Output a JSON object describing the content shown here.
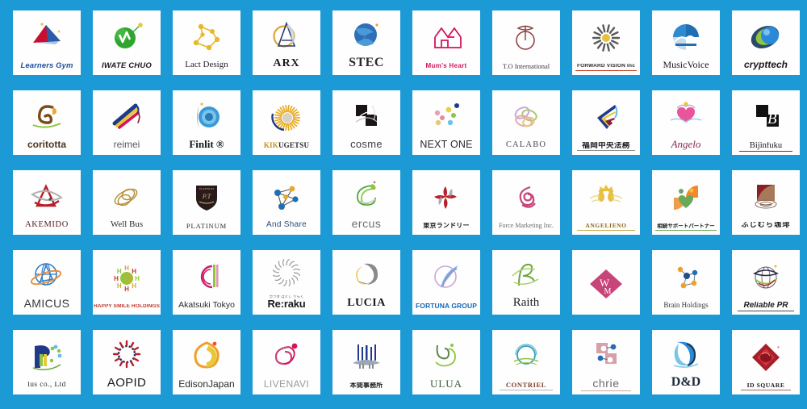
{
  "page": {
    "title": "Logo Design Portfolio Grid",
    "background_color": "#1b9ad6",
    "tile_background": "#fefefe",
    "columns": 10,
    "rows": 5,
    "total_logos": 50
  },
  "logos": [
    {
      "name": "Learners Gym",
      "caption": "Learners Gym",
      "mark": "triangle-flag-mark",
      "colors": [
        "#c8102e",
        "#1b4f9c",
        "#e8c040"
      ]
    },
    {
      "name": "IWATE CHUO",
      "caption": "IWATE CHUO",
      "mark": "green-circle-check-mark",
      "colors": [
        "#2fa42f",
        "#8ec63f"
      ]
    },
    {
      "name": "Lact Design",
      "caption": "Lact Design",
      "mark": "molecule-dots-mark",
      "colors": [
        "#e8b82a"
      ]
    },
    {
      "name": "ARX",
      "caption": "ARX",
      "mark": "gold-circle-a-mark",
      "colors": [
        "#d8a83a",
        "#2a4a8a"
      ]
    },
    {
      "name": "STEC",
      "caption": "STEC",
      "mark": "blue-globe-swoosh-mark",
      "colors": [
        "#1f5fa8",
        "#4a9ad8"
      ]
    },
    {
      "name": "Mum's Heart",
      "caption": "Mum's Heart",
      "mark": "pink-house-heart-mark",
      "colors": [
        "#d4145a"
      ]
    },
    {
      "name": "T.O International",
      "caption": "T.O International",
      "mark": "wine-circle-line-mark",
      "colors": [
        "#8a3a3a"
      ]
    },
    {
      "name": "FORWARD VISION Inc",
      "caption": "FORWARD  VISION  Inc",
      "mark": "burst-scatter-mark",
      "colors": [
        "#5a5a5a",
        "#e8c040"
      ]
    },
    {
      "name": "MusicVoice",
      "caption": "MusicVoice",
      "mark": "blue-fan-wave-mark",
      "colors": [
        "#1f6fb5"
      ]
    },
    {
      "name": "crypttech",
      "caption": "crypttech",
      "mark": "blue-green-sphere-mark",
      "colors": [
        "#1f6fb5",
        "#8ec63f"
      ]
    },
    {
      "name": "coritotta",
      "caption": "coritotta",
      "mark": "brown-ribbon-swirl-mark",
      "colors": [
        "#7a4a1a",
        "#e8a83a",
        "#8ec63f"
      ]
    },
    {
      "name": "reimei",
      "caption": "reimei",
      "mark": "colored-brush-strokes-mark",
      "colors": [
        "#1f3a8a",
        "#e8c83a",
        "#d4145a"
      ]
    },
    {
      "name": "Finlit",
      "caption": "Finlit ®",
      "mark": "blue-spiral-circle-mark",
      "colors": [
        "#2a8ad8",
        "#8a9aa8"
      ]
    },
    {
      "name": "KIKUGETSU",
      "caption": "KIKUGETSU",
      "caption_highlight": "KIK",
      "caption_rest": "UGETSU",
      "mark": "gold-sunburst-mark",
      "colors": [
        "#e8a81a",
        "#1f3a8a"
      ]
    },
    {
      "name": "cosme",
      "caption": "cosme",
      "mark": "black-squares-swirl-mark",
      "colors": [
        "#1a1414"
      ]
    },
    {
      "name": "NEXT ONE",
      "caption": "NEXT ONE",
      "mark": "colored-dots-scatter-mark",
      "colors": [
        "#e8a0b8",
        "#e8d04a",
        "#8ec63f",
        "#1f3a8a",
        "#4ab8d8"
      ]
    },
    {
      "name": "CALABO",
      "caption": "CALABO",
      "mark": "pastel-loops-mark",
      "colors": [
        "#c8a8d8",
        "#a8c878",
        "#e8a8a8"
      ]
    },
    {
      "name": "Fukuoka Chuo Houmu",
      "caption": "福岡中央法務",
      "mark": "tricolor-chevron-mark",
      "colors": [
        "#1f3a8a",
        "#e8c83a",
        "#8a1f35"
      ]
    },
    {
      "name": "Angelo",
      "caption": "Angelo",
      "mark": "pink-heart-wings-mark",
      "colors": [
        "#e8559a",
        "#8ac8e8",
        "#e8c83a"
      ]
    },
    {
      "name": "Bijinfuku",
      "caption": "Bijinfuku",
      "mark": "black-squares-b-mark",
      "colors": [
        "#1a1a1a",
        "#8a1f35"
      ]
    },
    {
      "name": "AKEMIDO",
      "caption": "AKEMIDO",
      "mark": "red-swoosh-a-mark",
      "colors": [
        "#b5202a",
        "#9a9a9a"
      ]
    },
    {
      "name": "Well Bus",
      "caption": "Well Bus",
      "mark": "gold-ellipse-loops-mark",
      "colors": [
        "#b5933a"
      ]
    },
    {
      "name": "PLATINUM",
      "caption": "PLATINUM",
      "mark": "dark-shield-crest-mark",
      "colors": [
        "#2a1a1a",
        "#c8b87a"
      ]
    },
    {
      "name": "And Share",
      "caption": "And  Share",
      "mark": "network-nodes-mark",
      "colors": [
        "#1f6fb5",
        "#e8a82a"
      ]
    },
    {
      "name": "ercus",
      "caption": "ercus",
      "mark": "green-leaf-swirl-mark",
      "colors": [
        "#4aa83a",
        "#8ec63f"
      ]
    },
    {
      "name": "Tokyo Laundry",
      "caption": "東京ランドリー",
      "mark": "red-pinwheel-mark",
      "colors": [
        "#b5202a",
        "#9a9a9a"
      ]
    },
    {
      "name": "Force Marketing Inc.",
      "caption": "Force Marketing Inc.",
      "mark": "pink-ribbon-knot-mark",
      "colors": [
        "#c8457a"
      ]
    },
    {
      "name": "ANGELIENO",
      "caption": "ANGELIENO",
      "mark": "gold-angels-crown-mark",
      "colors": [
        "#e8c040",
        "#c8a84a"
      ]
    },
    {
      "name": "Souzoku Support Partner",
      "caption": "相続サポートパートナー",
      "mark": "orange-green-people-mark",
      "colors": [
        "#f08a2a",
        "#6aa85a"
      ]
    },
    {
      "name": "Fujimura Coffee",
      "caption": "ふじむら珈琲",
      "mark": "brown-coffee-cup-mark",
      "colors": [
        "#8a1f25",
        "#a8785a"
      ]
    },
    {
      "name": "AMICUS",
      "caption": "AMICUS",
      "mark": "blue-globe-ring-mark",
      "colors": [
        "#2a7ac8",
        "#f08a2a"
      ]
    },
    {
      "name": "HAPPY SMILE HOLDINGS",
      "caption": "HAPPY SMILE HOLDINGS",
      "mark": "colorful-h-sun-mark",
      "colors": [
        "#d4a82a",
        "#c0392b",
        "#8ec63f"
      ]
    },
    {
      "name": "Akatsuki Tokyo",
      "caption": "Akatsuki Tokyo",
      "mark": "magenta-circle-bar-mark",
      "colors": [
        "#c8206a",
        "#8ec63f"
      ]
    },
    {
      "name": "Re:raku",
      "caption": "Re:raku",
      "caption_top": "カラダ ほぐし りらく",
      "mark": "line-burst-circle-mark",
      "colors": [
        "#9a9a9a"
      ]
    },
    {
      "name": "LUCIA",
      "caption": "LUCIA",
      "mark": "gold-gray-shell-mark",
      "colors": [
        "#e8b82a",
        "#8a8a8a"
      ]
    },
    {
      "name": "FORTUNA GROUP",
      "caption": "FORTUNA GROUP",
      "mark": "pastel-circle-swoosh-mark",
      "colors": [
        "#c8a8d8",
        "#6ab8e8"
      ]
    },
    {
      "name": "Raith",
      "caption": "Raith",
      "mark": "green-script-r-mark",
      "colors": [
        "#6aa83a"
      ]
    },
    {
      "name": "WM",
      "caption": "",
      "mark": "pink-diamond-wm-mark",
      "colors": [
        "#c8457a"
      ]
    },
    {
      "name": "Brain Holdings",
      "caption": "Brain Holdings",
      "mark": "molecule-network-mark",
      "colors": [
        "#1f6fb5",
        "#f0a02a"
      ]
    },
    {
      "name": "Reliable PR",
      "caption": "Reliable PR",
      "mark": "globe-ribbon-mark",
      "colors": [
        "#4a4a4a",
        "#8ac63f",
        "#b5202a"
      ]
    },
    {
      "name": "Plus co., Ltd",
      "caption": "lus  co., Ltd",
      "caption_prefix": "P",
      "mark": "blue-p-dots-mark",
      "colors": [
        "#1f3a8a",
        "#8ec63f",
        "#4a9ad8"
      ]
    },
    {
      "name": "AOPID",
      "caption": "AOPID",
      "mark": "red-ring-burst-mark",
      "colors": [
        "#b5202a",
        "#2a2a5a"
      ]
    },
    {
      "name": "EdisonJapan",
      "caption": "EdisonJapan",
      "mark": "orange-leaf-swirl-mark",
      "colors": [
        "#f0a02a",
        "#e8c83a"
      ]
    },
    {
      "name": "LIVENAVI",
      "caption": "LIVENAVI",
      "mark": "pink-butterfly-loop-mark",
      "colors": [
        "#c8457a",
        "#d4145a"
      ]
    },
    {
      "name": "Honma Jimusho",
      "caption": "本間事務所",
      "mark": "blue-pillars-mark",
      "colors": [
        "#1f3a8a",
        "#8a8a8a"
      ]
    },
    {
      "name": "ULUA",
      "caption": "ULUA",
      "mark": "green-script-swirl-mark",
      "colors": [
        "#5a8a4a",
        "#8ec63f"
      ]
    },
    {
      "name": "CONTRIEL",
      "caption": "CONTRIEL",
      "mark": "teal-circle-lines-mark",
      "colors": [
        "#3a9ab5",
        "#8ec63f"
      ]
    },
    {
      "name": "chrie",
      "caption": "chrie",
      "mark": "pink-squares-nodes-mark",
      "colors": [
        "#d8a0a8",
        "#2a6ab5"
      ]
    },
    {
      "name": "D&D",
      "caption": "D&D",
      "mark": "blue-d-swoosh-mark",
      "colors": [
        "#2a8ad8",
        "#1a3a5a"
      ]
    },
    {
      "name": "ID SQUARE",
      "caption": "ID SQUARE",
      "mark": "red-diamond-square-mark",
      "colors": [
        "#a51f2a",
        "#d4303a"
      ]
    }
  ]
}
